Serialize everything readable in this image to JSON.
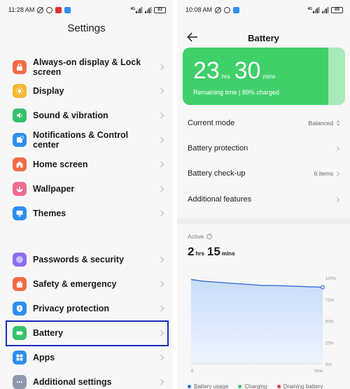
{
  "left": {
    "status": {
      "time": "11:28 AM",
      "battery": "83"
    },
    "title": "Settings",
    "items": [
      {
        "label": "Always-on display & Lock screen",
        "icon": "lock-screen-icon",
        "color": "#f26b47"
      },
      {
        "label": "Display",
        "icon": "sun-icon",
        "color": "#f5b630"
      },
      {
        "label": "Sound & vibration",
        "icon": "speaker-icon",
        "color": "#34c26a"
      },
      {
        "label": "Notifications & Control center",
        "icon": "notification-icon",
        "color": "#2e8ff0"
      },
      {
        "label": "Home screen",
        "icon": "home-icon",
        "color": "#f26b47"
      },
      {
        "label": "Wallpaper",
        "icon": "flower-icon",
        "color": "#f06a8c"
      },
      {
        "label": "Themes",
        "icon": "themes-icon",
        "color": "#2e8ff0"
      },
      {
        "label": "Passwords & security",
        "icon": "fingerprint-icon",
        "color": "#8a6ff0"
      },
      {
        "label": "Safety & emergency",
        "icon": "safety-icon",
        "color": "#f26b47"
      },
      {
        "label": "Privacy protection",
        "icon": "shield-icon",
        "color": "#2e8ff0"
      },
      {
        "label": "Battery",
        "icon": "battery-icon",
        "color": "#34c26a"
      },
      {
        "label": "Apps",
        "icon": "apps-icon",
        "color": "#2e8ff0"
      },
      {
        "label": "Additional settings",
        "icon": "more-icon",
        "color": "#8e99ad"
      }
    ]
  },
  "right": {
    "status": {
      "time": "10:08 AM",
      "battery": "89"
    },
    "title": "Battery",
    "card": {
      "hours": "23",
      "hours_unit": "hrs",
      "mins": "30",
      "mins_unit": "mins",
      "subtitle": "Remaining time | 89% charged",
      "color": "#3fd06a"
    },
    "menu": [
      {
        "label": "Current mode",
        "value": "Balanced"
      },
      {
        "label": "Battery protection",
        "value": ""
      },
      {
        "label": "Battery check-up",
        "value": "6 items"
      },
      {
        "label": "Additional features",
        "value": ""
      }
    ],
    "active": {
      "label": "Active",
      "hours": "2",
      "hours_unit": "hrs",
      "mins": "15",
      "mins_unit": "mins"
    },
    "chart_data": {
      "type": "area",
      "x_labels": [
        "8",
        "Now"
      ],
      "y_ticks": [
        "100%",
        "75%",
        "50%",
        "25%",
        "0%"
      ],
      "ylim": [
        0,
        100
      ],
      "series": [
        {
          "name": "Battery usage",
          "color": "#3a6fd8",
          "values": [
            98,
            96,
            95,
            94,
            93,
            92,
            91,
            91,
            90.5,
            90,
            89.5,
            89
          ]
        }
      ],
      "legend": [
        {
          "name": "Battery usage",
          "color": "#3a6fd8"
        },
        {
          "name": "Charging",
          "color": "#34c26a"
        },
        {
          "name": "Draining battery",
          "color": "#e04040"
        }
      ]
    }
  }
}
